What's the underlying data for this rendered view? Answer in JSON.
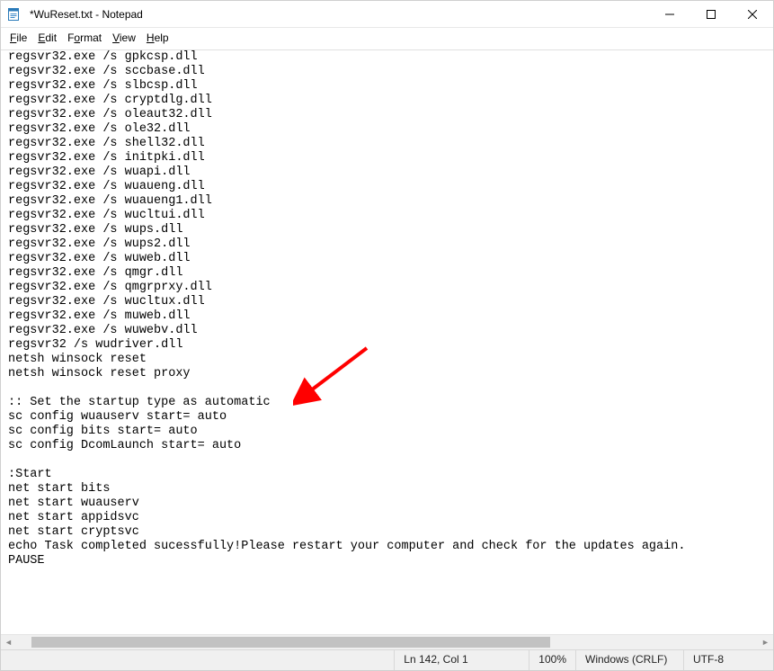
{
  "window": {
    "title": "*WuReset.txt - Notepad"
  },
  "menu": {
    "file": "File",
    "edit": "Edit",
    "format": "Format",
    "view": "View",
    "help": "Help"
  },
  "content": "regsvr32.exe /s gpkcsp.dll\nregsvr32.exe /s sccbase.dll\nregsvr32.exe /s slbcsp.dll\nregsvr32.exe /s cryptdlg.dll\nregsvr32.exe /s oleaut32.dll\nregsvr32.exe /s ole32.dll\nregsvr32.exe /s shell32.dll\nregsvr32.exe /s initpki.dll\nregsvr32.exe /s wuapi.dll\nregsvr32.exe /s wuaueng.dll\nregsvr32.exe /s wuaueng1.dll\nregsvr32.exe /s wucltui.dll\nregsvr32.exe /s wups.dll\nregsvr32.exe /s wups2.dll\nregsvr32.exe /s wuweb.dll\nregsvr32.exe /s qmgr.dll\nregsvr32.exe /s qmgrprxy.dll\nregsvr32.exe /s wucltux.dll\nregsvr32.exe /s muweb.dll\nregsvr32.exe /s wuwebv.dll\nregsvr32 /s wudriver.dll\nnetsh winsock reset\nnetsh winsock reset proxy\n\n:: Set the startup type as automatic\nsc config wuauserv start= auto\nsc config bits start= auto\nsc config DcomLaunch start= auto\n\n:Start\nnet start bits\nnet start wuauserv\nnet start appidsvc\nnet start cryptsvc\necho Task completed sucessfully!Please restart your computer and check for the updates again.\nPAUSE",
  "status": {
    "position": "Ln 142, Col 1",
    "zoom": "100%",
    "line_ending": "Windows (CRLF)",
    "encoding": "UTF-8"
  },
  "annotation": {
    "arrow_color": "#ff0000"
  }
}
